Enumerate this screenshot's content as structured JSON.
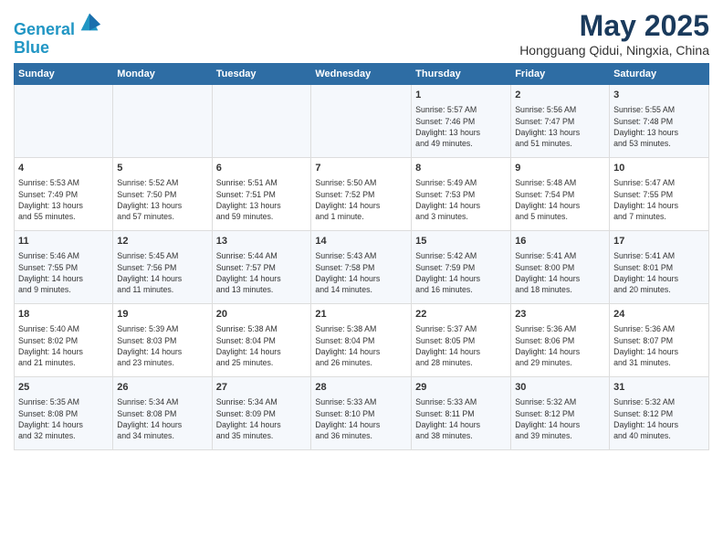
{
  "header": {
    "logo_line1": "General",
    "logo_line2": "Blue",
    "title": "May 2025",
    "subtitle": "Hongguang Qidui, Ningxia, China"
  },
  "days_of_week": [
    "Sunday",
    "Monday",
    "Tuesday",
    "Wednesday",
    "Thursday",
    "Friday",
    "Saturday"
  ],
  "weeks": [
    [
      {
        "day": "",
        "content": ""
      },
      {
        "day": "",
        "content": ""
      },
      {
        "day": "",
        "content": ""
      },
      {
        "day": "",
        "content": ""
      },
      {
        "day": "1",
        "content": "Sunrise: 5:57 AM\nSunset: 7:46 PM\nDaylight: 13 hours\nand 49 minutes."
      },
      {
        "day": "2",
        "content": "Sunrise: 5:56 AM\nSunset: 7:47 PM\nDaylight: 13 hours\nand 51 minutes."
      },
      {
        "day": "3",
        "content": "Sunrise: 5:55 AM\nSunset: 7:48 PM\nDaylight: 13 hours\nand 53 minutes."
      }
    ],
    [
      {
        "day": "4",
        "content": "Sunrise: 5:53 AM\nSunset: 7:49 PM\nDaylight: 13 hours\nand 55 minutes."
      },
      {
        "day": "5",
        "content": "Sunrise: 5:52 AM\nSunset: 7:50 PM\nDaylight: 13 hours\nand 57 minutes."
      },
      {
        "day": "6",
        "content": "Sunrise: 5:51 AM\nSunset: 7:51 PM\nDaylight: 13 hours\nand 59 minutes."
      },
      {
        "day": "7",
        "content": "Sunrise: 5:50 AM\nSunset: 7:52 PM\nDaylight: 14 hours\nand 1 minute."
      },
      {
        "day": "8",
        "content": "Sunrise: 5:49 AM\nSunset: 7:53 PM\nDaylight: 14 hours\nand 3 minutes."
      },
      {
        "day": "9",
        "content": "Sunrise: 5:48 AM\nSunset: 7:54 PM\nDaylight: 14 hours\nand 5 minutes."
      },
      {
        "day": "10",
        "content": "Sunrise: 5:47 AM\nSunset: 7:55 PM\nDaylight: 14 hours\nand 7 minutes."
      }
    ],
    [
      {
        "day": "11",
        "content": "Sunrise: 5:46 AM\nSunset: 7:55 PM\nDaylight: 14 hours\nand 9 minutes."
      },
      {
        "day": "12",
        "content": "Sunrise: 5:45 AM\nSunset: 7:56 PM\nDaylight: 14 hours\nand 11 minutes."
      },
      {
        "day": "13",
        "content": "Sunrise: 5:44 AM\nSunset: 7:57 PM\nDaylight: 14 hours\nand 13 minutes."
      },
      {
        "day": "14",
        "content": "Sunrise: 5:43 AM\nSunset: 7:58 PM\nDaylight: 14 hours\nand 14 minutes."
      },
      {
        "day": "15",
        "content": "Sunrise: 5:42 AM\nSunset: 7:59 PM\nDaylight: 14 hours\nand 16 minutes."
      },
      {
        "day": "16",
        "content": "Sunrise: 5:41 AM\nSunset: 8:00 PM\nDaylight: 14 hours\nand 18 minutes."
      },
      {
        "day": "17",
        "content": "Sunrise: 5:41 AM\nSunset: 8:01 PM\nDaylight: 14 hours\nand 20 minutes."
      }
    ],
    [
      {
        "day": "18",
        "content": "Sunrise: 5:40 AM\nSunset: 8:02 PM\nDaylight: 14 hours\nand 21 minutes."
      },
      {
        "day": "19",
        "content": "Sunrise: 5:39 AM\nSunset: 8:03 PM\nDaylight: 14 hours\nand 23 minutes."
      },
      {
        "day": "20",
        "content": "Sunrise: 5:38 AM\nSunset: 8:04 PM\nDaylight: 14 hours\nand 25 minutes."
      },
      {
        "day": "21",
        "content": "Sunrise: 5:38 AM\nSunset: 8:04 PM\nDaylight: 14 hours\nand 26 minutes."
      },
      {
        "day": "22",
        "content": "Sunrise: 5:37 AM\nSunset: 8:05 PM\nDaylight: 14 hours\nand 28 minutes."
      },
      {
        "day": "23",
        "content": "Sunrise: 5:36 AM\nSunset: 8:06 PM\nDaylight: 14 hours\nand 29 minutes."
      },
      {
        "day": "24",
        "content": "Sunrise: 5:36 AM\nSunset: 8:07 PM\nDaylight: 14 hours\nand 31 minutes."
      }
    ],
    [
      {
        "day": "25",
        "content": "Sunrise: 5:35 AM\nSunset: 8:08 PM\nDaylight: 14 hours\nand 32 minutes."
      },
      {
        "day": "26",
        "content": "Sunrise: 5:34 AM\nSunset: 8:08 PM\nDaylight: 14 hours\nand 34 minutes."
      },
      {
        "day": "27",
        "content": "Sunrise: 5:34 AM\nSunset: 8:09 PM\nDaylight: 14 hours\nand 35 minutes."
      },
      {
        "day": "28",
        "content": "Sunrise: 5:33 AM\nSunset: 8:10 PM\nDaylight: 14 hours\nand 36 minutes."
      },
      {
        "day": "29",
        "content": "Sunrise: 5:33 AM\nSunset: 8:11 PM\nDaylight: 14 hours\nand 38 minutes."
      },
      {
        "day": "30",
        "content": "Sunrise: 5:32 AM\nSunset: 8:12 PM\nDaylight: 14 hours\nand 39 minutes."
      },
      {
        "day": "31",
        "content": "Sunrise: 5:32 AM\nSunset: 8:12 PM\nDaylight: 14 hours\nand 40 minutes."
      }
    ]
  ]
}
